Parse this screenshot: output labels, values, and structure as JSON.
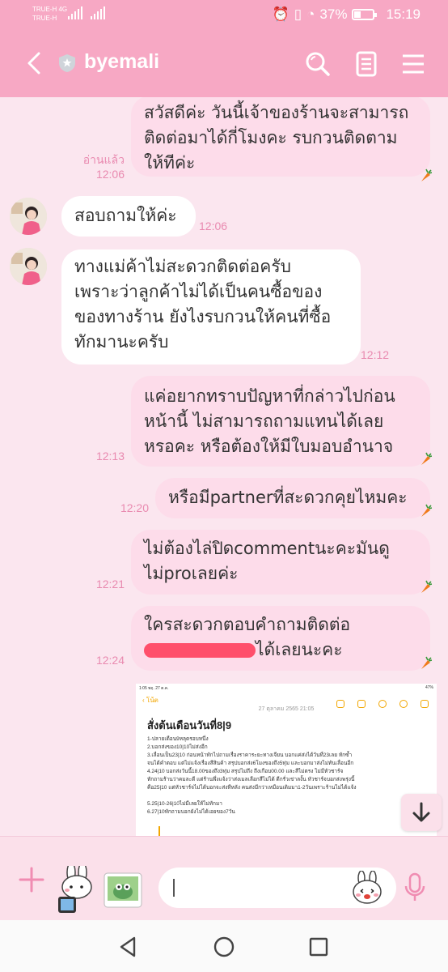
{
  "status": {
    "carrier1": "TRUE-H 4G",
    "carrier2": "TRUE-H",
    "battery": "37%",
    "battery_level": 0.37,
    "time": "15:19"
  },
  "header": {
    "title": "byemali"
  },
  "messages": [
    {
      "side": "me",
      "text": "สวัสดีค่ะ วันนี้เจ้าของร้านจะสามารถ\nติดต่อมาได้กี่โมงคะ รบกวนติดตาม\nให้ทีค่ะ",
      "read": "อ่านแล้ว",
      "time": "12:06"
    },
    {
      "side": "them",
      "text": "สอบถามให้ค่ะ",
      "time": "12:06"
    },
    {
      "side": "them",
      "text": "ทางแม่ค้าไม่สะดวกติดต่อครับ\nเพราะว่าลูกค้าไม่ได้เป็นคนซื้อของ\nของทางร้าน ยังไงรบกวนให้คนที่ซื้อ\nทักมานะครับ",
      "time": "12:12"
    },
    {
      "side": "me",
      "text": "แค่อยากทราบปัญหาที่กล่าวไปก่อน\nหน้านี้ ไม่สามารถถามแทนได้เลย\nหรอคะ หรือต้องให้มีใบมอบอำนาจ",
      "time": "12:13"
    },
    {
      "side": "me",
      "text": "หรือมีpartnerที่สะดวกคุยไหมคะ",
      "time": "12:20"
    },
    {
      "side": "me",
      "text": "ไม่ต้องไล่ปิดcommentนะคะมันดู\nไม่proเลยค่ะ",
      "time": "12:21"
    },
    {
      "side": "me",
      "text_line1": "ใครสะดวกตอบคำถามติดต่อ",
      "text_line2_tail": "ได้เลยนะคะ",
      "time": "12:24"
    }
  ],
  "shared_image": {
    "status_left": "1:05  พฤ. 27 ต.ค.",
    "status_right": "47%",
    "nav_back": "โน้ต",
    "date": "27 ตุลาคม 2565 21:05",
    "heading": "สั่งต้นเดือนวันที่8|9",
    "lines": [
      "1-ปลายเดือน9หลุดรอบหนึ่ง",
      "2.บอกส่งของ10|10ไม่ส่งอีก",
      "3.เลื่อนเป็น23|10 ก่อนหน้าทักไปถามเรื่องราคาระยะทางเจียน  บอกแค่ส่งได้วันที่23เลย  ทักซ้ำ",
      "จนได้คำตอบ  แต่ไม่แจ้งเรื่องสีสินค้า  สรุปบอกส่ง6โมงของถึง5ทุ่ม  และบอกมาส่งไม่ทันเลื่อนอีก",
      "4.24|10  บอกส่งวันนี้18.00ของถึง3ทุ่ม  สรุปไม่ถึง  ถึงเกือบ00.00 และสีไม่ตรง  ไม่มีหัวชาร์จ",
      "ทักถามร้านว่าคมละดี  แต่ร้านพึ่งแจ้งว่าส่งเมลเลือกสีไม่ได้  ดีกรั่วเข่าลงั้น  หัวชาร์จบอกส่งพรุ่งนี้",
      "คือ25|10 แต่หัวชาร์จไม่ได้บอกจะส่งทีหลัง  คนส่งมีกว่าเหมือนเดิมมา1-2วันเพราะร้านไม่ได้แจ้ง",
      "",
      "5.25|10-26|10ไม่มีเลยให้ไม่ทักมา",
      "6.27|10ทักถามบอกยังไม่ได้เอยของ7วัน"
    ]
  },
  "colors": {
    "accent": "#f7a8c4",
    "my_bubble": "#fddcea",
    "their_bubble": "#ffffff",
    "timestamp": "#e98ab0",
    "chat_bg": "#fbe6ef"
  },
  "icons": [
    "back-arrow-icon",
    "shield-star-icon",
    "search-icon",
    "notes-icon",
    "menu-icon",
    "plus-icon",
    "sticker-icon",
    "photo-icon",
    "emoji-icon",
    "mic-icon",
    "carrot-icon",
    "scroll-down-icon"
  ]
}
